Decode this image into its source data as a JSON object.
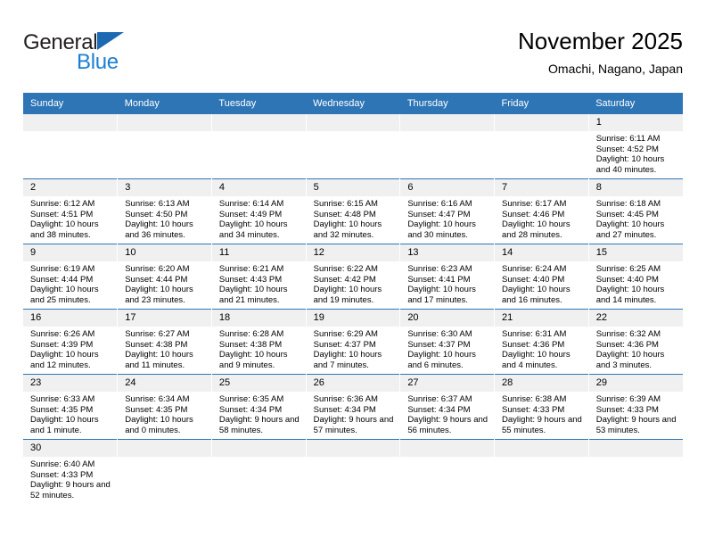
{
  "brand": {
    "name_part1": "General",
    "name_part2": "Blue"
  },
  "header": {
    "title": "November 2025",
    "subtitle": "Omachi, Nagano, Japan"
  },
  "colors": {
    "header_blue": "#2e75b6",
    "brand_blue": "#1b7fd4",
    "flag_blue": "#1b68b3",
    "daynum_band": "#f0f0f0"
  },
  "weekdays": [
    "Sunday",
    "Monday",
    "Tuesday",
    "Wednesday",
    "Thursday",
    "Friday",
    "Saturday"
  ],
  "weeks": [
    [
      {
        "day": "",
        "empty": true
      },
      {
        "day": "",
        "empty": true
      },
      {
        "day": "",
        "empty": true
      },
      {
        "day": "",
        "empty": true
      },
      {
        "day": "",
        "empty": true
      },
      {
        "day": "",
        "empty": true
      },
      {
        "day": "1",
        "sunrise": "Sunrise: 6:11 AM",
        "sunset": "Sunset: 4:52 PM",
        "daylight": "Daylight: 10 hours and 40 minutes."
      }
    ],
    [
      {
        "day": "2",
        "sunrise": "Sunrise: 6:12 AM",
        "sunset": "Sunset: 4:51 PM",
        "daylight": "Daylight: 10 hours and 38 minutes."
      },
      {
        "day": "3",
        "sunrise": "Sunrise: 6:13 AM",
        "sunset": "Sunset: 4:50 PM",
        "daylight": "Daylight: 10 hours and 36 minutes."
      },
      {
        "day": "4",
        "sunrise": "Sunrise: 6:14 AM",
        "sunset": "Sunset: 4:49 PM",
        "daylight": "Daylight: 10 hours and 34 minutes."
      },
      {
        "day": "5",
        "sunrise": "Sunrise: 6:15 AM",
        "sunset": "Sunset: 4:48 PM",
        "daylight": "Daylight: 10 hours and 32 minutes."
      },
      {
        "day": "6",
        "sunrise": "Sunrise: 6:16 AM",
        "sunset": "Sunset: 4:47 PM",
        "daylight": "Daylight: 10 hours and 30 minutes."
      },
      {
        "day": "7",
        "sunrise": "Sunrise: 6:17 AM",
        "sunset": "Sunset: 4:46 PM",
        "daylight": "Daylight: 10 hours and 28 minutes."
      },
      {
        "day": "8",
        "sunrise": "Sunrise: 6:18 AM",
        "sunset": "Sunset: 4:45 PM",
        "daylight": "Daylight: 10 hours and 27 minutes."
      }
    ],
    [
      {
        "day": "9",
        "sunrise": "Sunrise: 6:19 AM",
        "sunset": "Sunset: 4:44 PM",
        "daylight": "Daylight: 10 hours and 25 minutes."
      },
      {
        "day": "10",
        "sunrise": "Sunrise: 6:20 AM",
        "sunset": "Sunset: 4:44 PM",
        "daylight": "Daylight: 10 hours and 23 minutes."
      },
      {
        "day": "11",
        "sunrise": "Sunrise: 6:21 AM",
        "sunset": "Sunset: 4:43 PM",
        "daylight": "Daylight: 10 hours and 21 minutes."
      },
      {
        "day": "12",
        "sunrise": "Sunrise: 6:22 AM",
        "sunset": "Sunset: 4:42 PM",
        "daylight": "Daylight: 10 hours and 19 minutes."
      },
      {
        "day": "13",
        "sunrise": "Sunrise: 6:23 AM",
        "sunset": "Sunset: 4:41 PM",
        "daylight": "Daylight: 10 hours and 17 minutes."
      },
      {
        "day": "14",
        "sunrise": "Sunrise: 6:24 AM",
        "sunset": "Sunset: 4:40 PM",
        "daylight": "Daylight: 10 hours and 16 minutes."
      },
      {
        "day": "15",
        "sunrise": "Sunrise: 6:25 AM",
        "sunset": "Sunset: 4:40 PM",
        "daylight": "Daylight: 10 hours and 14 minutes."
      }
    ],
    [
      {
        "day": "16",
        "sunrise": "Sunrise: 6:26 AM",
        "sunset": "Sunset: 4:39 PM",
        "daylight": "Daylight: 10 hours and 12 minutes."
      },
      {
        "day": "17",
        "sunrise": "Sunrise: 6:27 AM",
        "sunset": "Sunset: 4:38 PM",
        "daylight": "Daylight: 10 hours and 11 minutes."
      },
      {
        "day": "18",
        "sunrise": "Sunrise: 6:28 AM",
        "sunset": "Sunset: 4:38 PM",
        "daylight": "Daylight: 10 hours and 9 minutes."
      },
      {
        "day": "19",
        "sunrise": "Sunrise: 6:29 AM",
        "sunset": "Sunset: 4:37 PM",
        "daylight": "Daylight: 10 hours and 7 minutes."
      },
      {
        "day": "20",
        "sunrise": "Sunrise: 6:30 AM",
        "sunset": "Sunset: 4:37 PM",
        "daylight": "Daylight: 10 hours and 6 minutes."
      },
      {
        "day": "21",
        "sunrise": "Sunrise: 6:31 AM",
        "sunset": "Sunset: 4:36 PM",
        "daylight": "Daylight: 10 hours and 4 minutes."
      },
      {
        "day": "22",
        "sunrise": "Sunrise: 6:32 AM",
        "sunset": "Sunset: 4:36 PM",
        "daylight": "Daylight: 10 hours and 3 minutes."
      }
    ],
    [
      {
        "day": "23",
        "sunrise": "Sunrise: 6:33 AM",
        "sunset": "Sunset: 4:35 PM",
        "daylight": "Daylight: 10 hours and 1 minute."
      },
      {
        "day": "24",
        "sunrise": "Sunrise: 6:34 AM",
        "sunset": "Sunset: 4:35 PM",
        "daylight": "Daylight: 10 hours and 0 minutes."
      },
      {
        "day": "25",
        "sunrise": "Sunrise: 6:35 AM",
        "sunset": "Sunset: 4:34 PM",
        "daylight": "Daylight: 9 hours and 58 minutes."
      },
      {
        "day": "26",
        "sunrise": "Sunrise: 6:36 AM",
        "sunset": "Sunset: 4:34 PM",
        "daylight": "Daylight: 9 hours and 57 minutes."
      },
      {
        "day": "27",
        "sunrise": "Sunrise: 6:37 AM",
        "sunset": "Sunset: 4:34 PM",
        "daylight": "Daylight: 9 hours and 56 minutes."
      },
      {
        "day": "28",
        "sunrise": "Sunrise: 6:38 AM",
        "sunset": "Sunset: 4:33 PM",
        "daylight": "Daylight: 9 hours and 55 minutes."
      },
      {
        "day": "29",
        "sunrise": "Sunrise: 6:39 AM",
        "sunset": "Sunset: 4:33 PM",
        "daylight": "Daylight: 9 hours and 53 minutes."
      }
    ],
    [
      {
        "day": "30",
        "sunrise": "Sunrise: 6:40 AM",
        "sunset": "Sunset: 4:33 PM",
        "daylight": "Daylight: 9 hours and 52 minutes."
      },
      {
        "day": "",
        "empty": true
      },
      {
        "day": "",
        "empty": true
      },
      {
        "day": "",
        "empty": true
      },
      {
        "day": "",
        "empty": true
      },
      {
        "day": "",
        "empty": true
      },
      {
        "day": "",
        "empty": true
      }
    ]
  ]
}
